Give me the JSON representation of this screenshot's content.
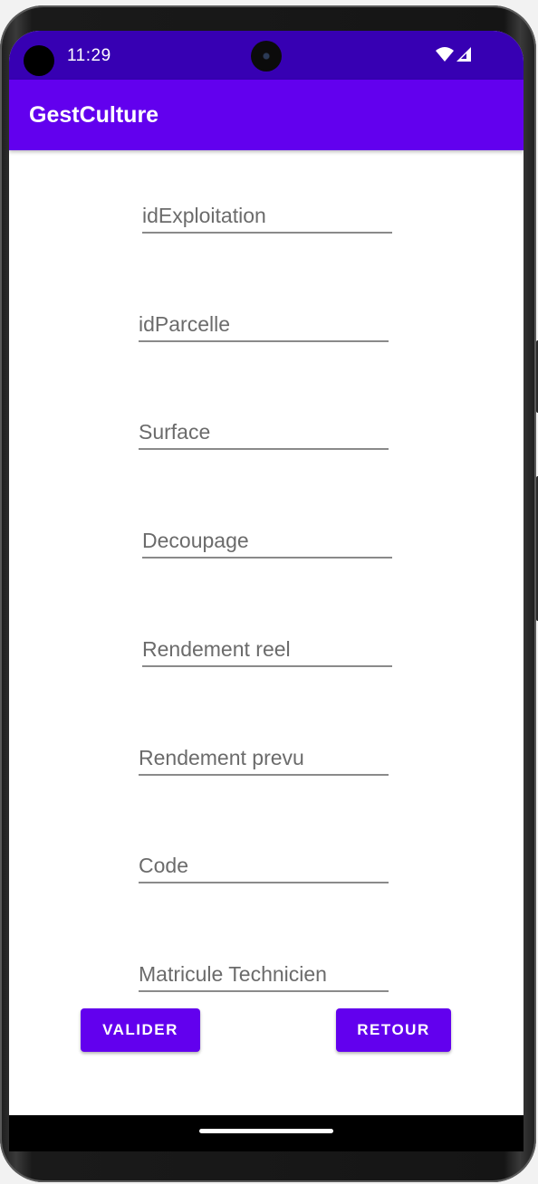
{
  "status_bar": {
    "time": "11:29",
    "icons": [
      "wifi-icon",
      "signal-icon"
    ]
  },
  "app_bar": {
    "title": "GestCulture"
  },
  "form": {
    "fields": [
      {
        "placeholder": "idExploitation",
        "value": ""
      },
      {
        "placeholder": "idParcelle",
        "value": ""
      },
      {
        "placeholder": "Surface",
        "value": ""
      },
      {
        "placeholder": "Decoupage",
        "value": ""
      },
      {
        "placeholder": "Rendement reel",
        "value": ""
      },
      {
        "placeholder": "Rendement prevu",
        "value": ""
      },
      {
        "placeholder": "Code",
        "value": ""
      },
      {
        "placeholder": "Matricule Technicien",
        "value": ""
      }
    ]
  },
  "actions": {
    "valider_label": "VALIDER",
    "retour_label": "RETOUR"
  },
  "colors": {
    "status_bar": "#3700b3",
    "primary": "#6200ee",
    "background": "#ffffff"
  }
}
